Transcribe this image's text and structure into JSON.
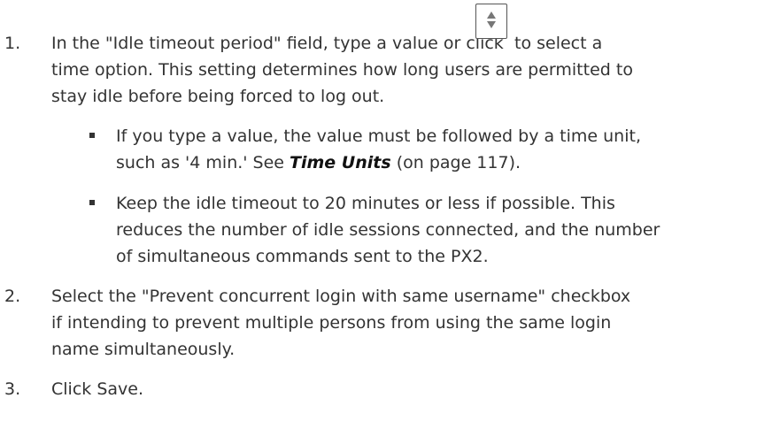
{
  "steps": [
    {
      "number": "1.",
      "lines": [
        {
          "before_icon": "In the \"Idle timeout period\" field, type a value or click",
          "after_icon": "to select a"
        },
        "time option. This setting determines how long users are permitted to",
        "stay idle before being forced to log out."
      ],
      "icon": "spinner-up-down-icon",
      "bullets": [
        {
          "lines": [
            "If you type a value, the value must be followed by a time unit,",
            {
              "before_ref": "such as '4 min.' See ",
              "ref": "Time Units",
              "after_ref": " (on page 117)."
            }
          ]
        },
        {
          "lines": [
            "Keep the idle timeout to 20 minutes or less if possible. This",
            "reduces the number of idle sessions connected, and the number",
            "of simultaneous commands sent to the PX2."
          ]
        }
      ]
    },
    {
      "number": "2.",
      "lines": [
        "Select the \"Prevent concurrent login with same username\" checkbox",
        "if intending to prevent multiple persons from using the same login",
        "name simultaneously."
      ]
    },
    {
      "number": "3.",
      "lines": [
        "Click Save."
      ]
    }
  ]
}
